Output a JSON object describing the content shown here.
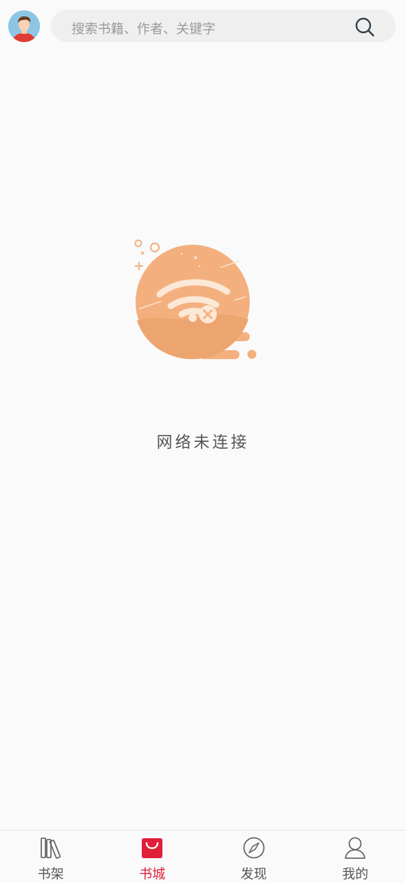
{
  "search": {
    "placeholder": "搜索书籍、作者、关键字"
  },
  "status": {
    "message": "网络未连接"
  },
  "tabs": [
    {
      "label": "书架",
      "icon": "bookshelf-icon",
      "active": false
    },
    {
      "label": "书城",
      "icon": "shopping-bag-icon",
      "active": true
    },
    {
      "label": "发现",
      "icon": "compass-icon",
      "active": false
    },
    {
      "label": "我的",
      "icon": "user-icon",
      "active": false
    }
  ],
  "colors": {
    "accent": "#e0203a",
    "illustration": "#f3b07e",
    "background": "#fafafa"
  }
}
